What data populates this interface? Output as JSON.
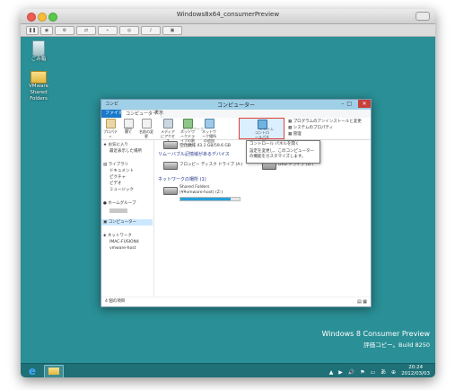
{
  "window": {
    "title": "Windows8x64_consumerPreview"
  },
  "desktop": {
    "icons": [
      {
        "label": "ごみ箱"
      },
      {
        "label": "VMware Shared Folders"
      }
    ],
    "watermark": {
      "line1": "Windows 8 Consumer Preview",
      "line2": "評価コピー。Build 8250"
    }
  },
  "explorer": {
    "title": "コンピューター",
    "qat_label": "コンピ",
    "tabs": [
      "ファイル",
      "コンピューター",
      "表示"
    ],
    "ribbon": [
      {
        "label": "プロパティ"
      },
      {
        "label": "開く"
      },
      {
        "label": "名前の変更"
      },
      {
        "label": "メディアにアクセス"
      },
      {
        "label": "ネットワークドライブの割り当て"
      },
      {
        "label": "ネットワーク場所の追加"
      },
      {
        "label": "コントロールパネルを開く"
      }
    ],
    "ribbon_side": [
      "プログラムのアンインストールと変更",
      "システムのプロパティ",
      "管理"
    ],
    "ribbon_groups": [
      "場所",
      "ネットワーク",
      "システム"
    ],
    "tooltip": {
      "title": "コントロール パネルを開く",
      "body": "設定を変更し、このコンピューターの機能をカスタマイズします。"
    },
    "nav": [
      "お気に入り",
      "最近表示した場所",
      "ライブラリ",
      "ドキュメント",
      "ピクチャ",
      "ビデオ",
      "ミュージック",
      "ホームグループ",
      "コンピューター",
      "ネットワーク",
      "IMAC-FUSION4",
      "vmware-host"
    ],
    "content": {
      "drive_c_size": "空き領域 43.1 GB/59.6 GB",
      "removable_header": "リムーバブル記憶域があるデバイス",
      "floppy": "フロッピー ディスク ドライブ (A:)",
      "dvd": "DVD ドライブ (D:)",
      "network_header": "ネットワークの場所 (1)",
      "share_name": "Shared Folders",
      "share_path": "(¥¥vmware-host) (Z:)",
      "share_fill": 0.85
    },
    "status": "4 個の項目"
  },
  "taskbar": {
    "tray": "▲ ▶ 🔊 ⚑ ▭ あ ⊕",
    "time": "20:24",
    "date": "2012/03/03"
  }
}
